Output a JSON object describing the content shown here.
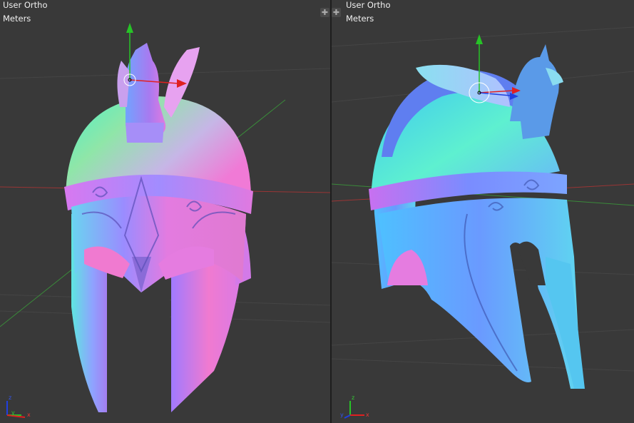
{
  "left_viewport": {
    "view_label": "User Ortho",
    "units_label": "Meters",
    "axis_labels": {
      "z": "z",
      "y": "y",
      "x": "x"
    }
  },
  "right_viewport": {
    "view_label": "User Ortho",
    "units_label": "Meters",
    "axis_labels": {
      "z": "z",
      "y": "y",
      "x": "x"
    }
  },
  "icons": {
    "split_handle_left": "plus-icon",
    "split_handle_right": "plus-icon"
  },
  "colors": {
    "viewport_bg": "#393939",
    "grid": "#4a4a4a",
    "axis_x": "#b53b3b",
    "axis_y": "#3f9a3f",
    "gizmo_z": "#27c327",
    "gizmo_x": "#e02020",
    "gizmo_y": "#2040e0"
  }
}
